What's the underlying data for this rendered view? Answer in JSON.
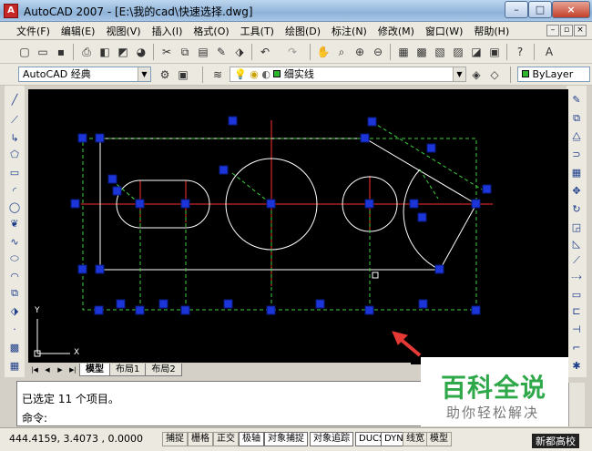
{
  "window": {
    "title": "AutoCAD 2007 - [E:\\我的cad\\快速选择.dwg]",
    "app_icon": "autocad-logo",
    "minimize": "–",
    "maximize": "□",
    "close": "×"
  },
  "menubar": {
    "items": [
      "文件(F)",
      "编辑(E)",
      "视图(V)",
      "插入(I)",
      "格式(O)",
      "工具(T)",
      "绘图(D)",
      "标注(N)",
      "修改(M)",
      "窗口(W)",
      "帮助(H)"
    ]
  },
  "workspace": {
    "selected": "AutoCAD 经典"
  },
  "layer": {
    "selected": "细实线"
  },
  "color": {
    "selected": "ByLayer"
  },
  "tabs": {
    "model": "模型",
    "layout1": "布局1",
    "layout2": "布局2"
  },
  "ucs": {
    "x_label": "X",
    "y_label": "Y"
  },
  "command": {
    "history": "已选定 11 个项目。",
    "prompt": "命令:"
  },
  "status": {
    "coords": "444.4159, 3.4073 , 0.0000",
    "buttons": [
      "捕捉",
      "栅格",
      "正交",
      "极轴",
      "对象捕捉",
      "对象追踪",
      "DUCS",
      "DYN",
      "线宽",
      "模型"
    ]
  },
  "watermark": {
    "big": "百科全说",
    "small": "助你轻松解决"
  },
  "brand": "新都高校",
  "colors": {
    "canvas": "#000000",
    "drawing_line": "#ffffff",
    "center_line": "#ff3030",
    "selection_dash": "#3fcf3f",
    "grip": "#1b35d8",
    "annotation_arrow": "#e53935"
  }
}
